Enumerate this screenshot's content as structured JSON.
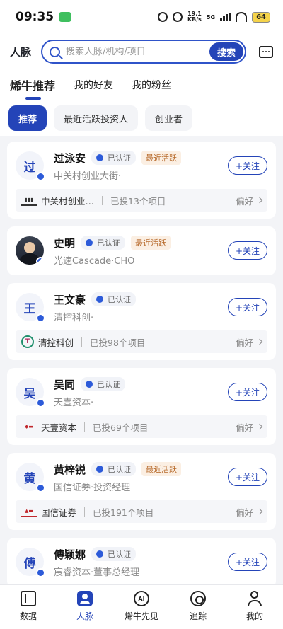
{
  "status": {
    "time": "09:35",
    "netspeed_top": "19.1",
    "netspeed_unit": "KB/s",
    "network": "5G",
    "battery": "64"
  },
  "header": {
    "title": "人脉",
    "search_placeholder": "搜索人脉/机构/项目",
    "search_button": "搜索"
  },
  "tabs": [
    {
      "label": "烯牛推荐"
    },
    {
      "label": "我的好友"
    },
    {
      "label": "我的粉丝"
    }
  ],
  "filters": [
    {
      "label": "推荐"
    },
    {
      "label": "最近活跃投资人"
    },
    {
      "label": "创业者"
    }
  ],
  "people": [
    {
      "avatar": "过",
      "name": "过泳安",
      "cert": "已认证",
      "active": "最近活跃",
      "subtitle": "中关村创业大街·",
      "follow": "+关注",
      "org": {
        "logo": "zgc",
        "name": "中关村创业…",
        "invest": "已投13个项目",
        "pref": "偏好"
      }
    },
    {
      "avatar": "",
      "name": "史明",
      "cert": "已认证",
      "active": "最近活跃",
      "subtitle": "光速Cascade·CHO",
      "follow": "+关注"
    },
    {
      "avatar": "王",
      "name": "王文豪",
      "cert": "已认证",
      "subtitle": "清控科创·",
      "follow": "+关注",
      "org": {
        "logo": "T",
        "name": "清控科创",
        "invest": "已投98个项目",
        "pref": "偏好"
      }
    },
    {
      "avatar": "吴",
      "name": "吴同",
      "cert": "已认证",
      "subtitle": "天壹资本·",
      "follow": "+关注",
      "org": {
        "logo": "ty",
        "name": "天壹资本",
        "invest": "已投69个项目",
        "pref": "偏好"
      }
    },
    {
      "avatar": "黄",
      "name": "黄梓锐",
      "cert": "已认证",
      "active": "最近活跃",
      "subtitle": "国信证券·投资经理",
      "follow": "+关注",
      "org": {
        "logo": "gx",
        "name": "国信证券",
        "invest": "已投191个项目",
        "pref": "偏好"
      }
    },
    {
      "avatar": "傅",
      "name": "傅颖娜",
      "cert": "已认证",
      "subtitle": "宸睿资本·董事总经理",
      "follow": "+关注"
    }
  ],
  "nav": [
    {
      "label": "数据"
    },
    {
      "label": "人脉"
    },
    {
      "label": "烯牛先见"
    },
    {
      "label": "追踪"
    },
    {
      "label": "我的"
    }
  ],
  "colors": {
    "brand": "#2444b8",
    "active_tag_bg": "#fbefe3",
    "active_tag_text": "#b76a2b"
  }
}
